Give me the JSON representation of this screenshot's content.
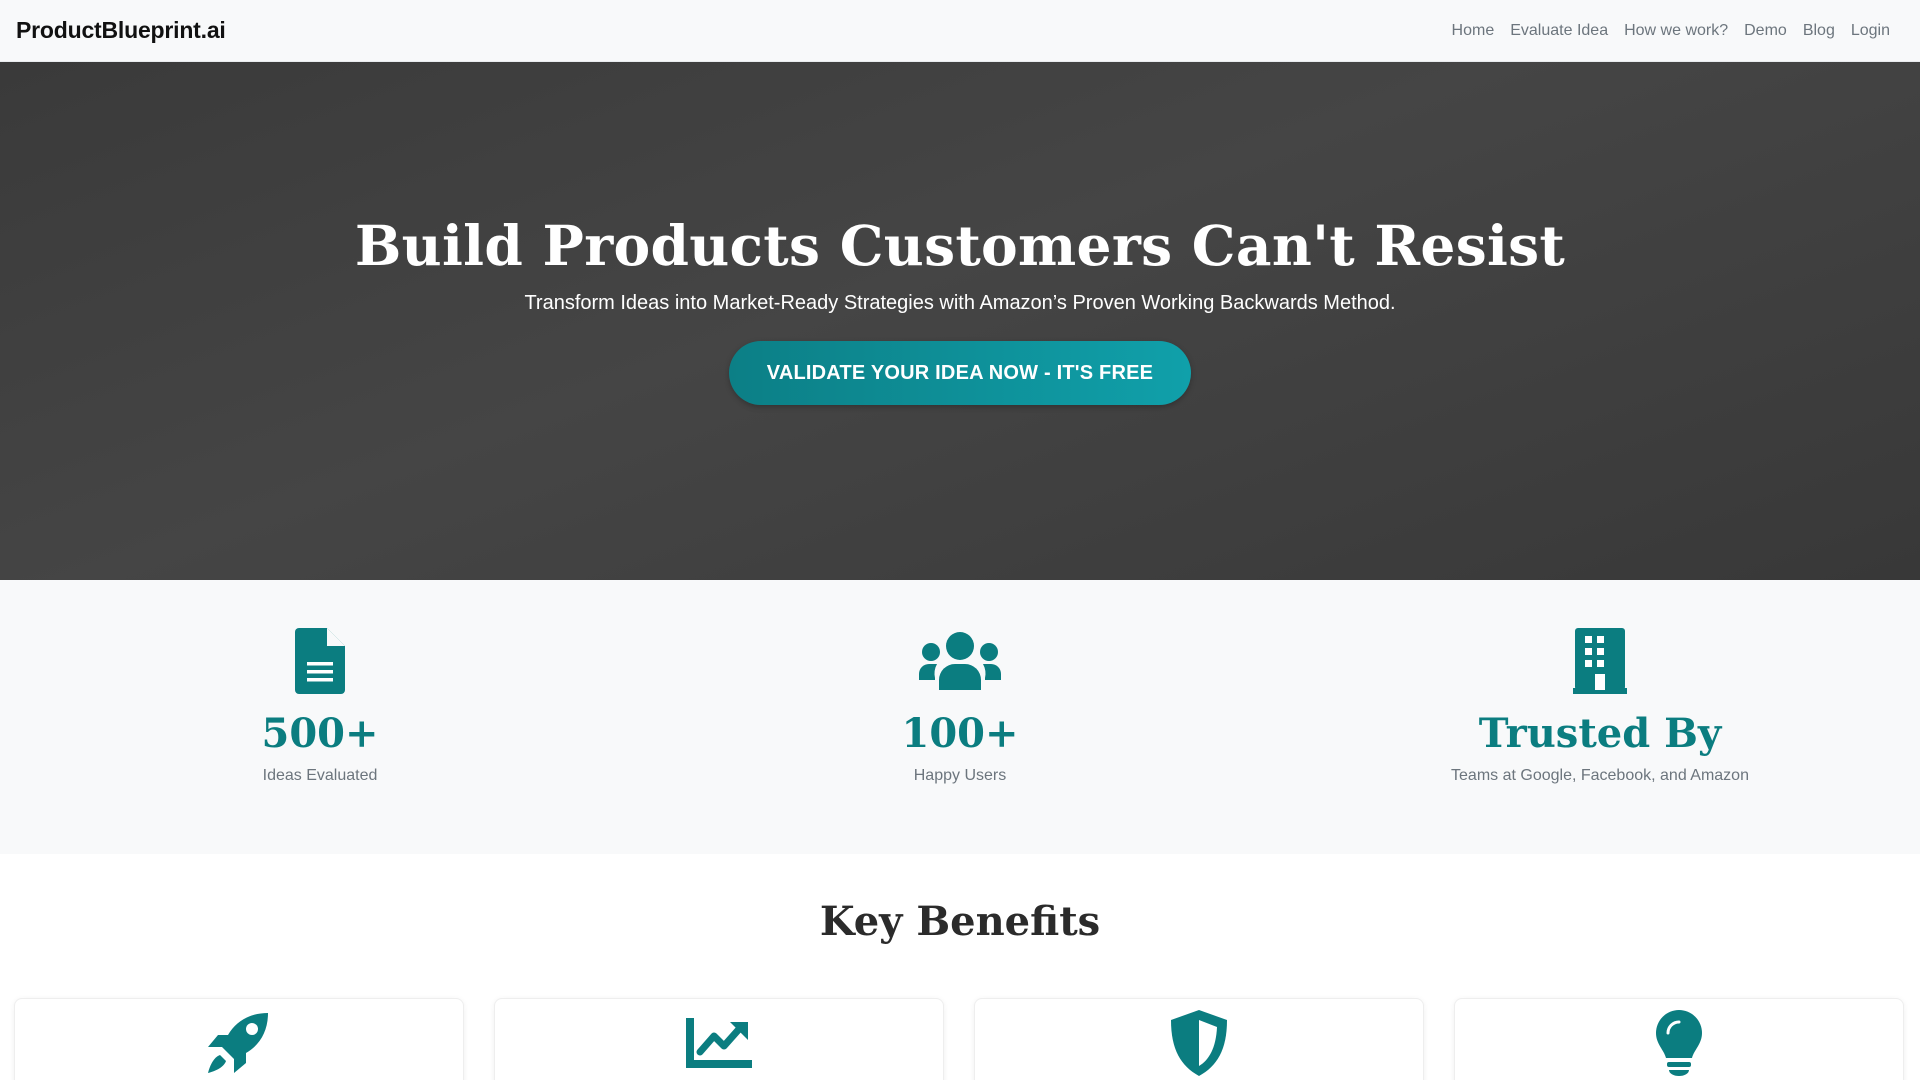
{
  "brand": "ProductBlueprint.ai",
  "nav": [
    "Home",
    "Evaluate Idea",
    "How we work?",
    "Demo",
    "Blog",
    "Login"
  ],
  "hero": {
    "title": "Build Products Customers Can't Resist",
    "subtitle": "Transform Ideas into Market-Ready Strategies with Amazon’s Proven Working Backwards Method.",
    "cta": "VALIDATE YOUR IDEA NOW - IT'S FREE"
  },
  "stats": [
    {
      "icon": "document-icon",
      "value": "500+",
      "label": "Ideas Evaluated"
    },
    {
      "icon": "users-icon",
      "value": "100+",
      "label": "Happy Users"
    },
    {
      "icon": "building-icon",
      "value": "Trusted By",
      "label": "Teams at Google, Facebook, and Amazon"
    }
  ],
  "benefits": {
    "title": "Key Benefits",
    "cards": [
      {
        "icon": "rocket-icon"
      },
      {
        "icon": "chart-line-icon"
      },
      {
        "icon": "shield-icon"
      },
      {
        "icon": "lightbulb-icon"
      }
    ]
  },
  "colors": {
    "accent": "#0b7d80",
    "hero_bg": "#3f3f3f",
    "cta_start": "#0c7f86",
    "cta_end": "#10a0aa"
  }
}
